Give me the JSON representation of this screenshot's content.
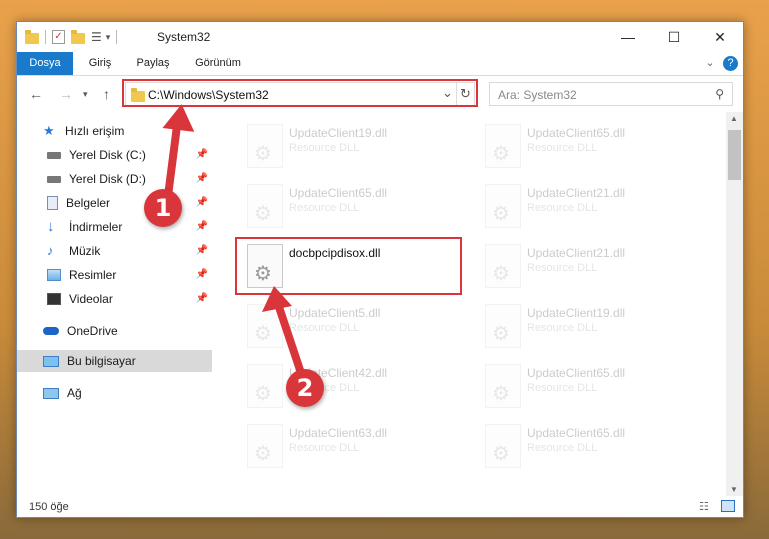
{
  "window": {
    "title": "System32",
    "controls": {
      "minimize": "—",
      "maximize": "☐",
      "close": "✕"
    }
  },
  "ribbon": {
    "tabs": [
      "Dosya",
      "Giriş",
      "Paylaş",
      "Görünüm"
    ],
    "help": "?",
    "collapse": "⌄"
  },
  "navbar": {
    "address": "C:\\Windows\\System32",
    "search_placeholder": "Ara: System32",
    "refresh_icon": "↻",
    "dropdown_icon": "⌄"
  },
  "nav_pane": {
    "items": [
      {
        "label": "Hızlı erişim",
        "icon": "star-icon",
        "pinned": false
      },
      {
        "label": "Yerel Disk (C:)",
        "icon": "drive-icon",
        "pinned": true
      },
      {
        "label": "Yerel Disk (D:)",
        "icon": "drive-icon",
        "pinned": true
      },
      {
        "label": "Belgeler",
        "icon": "documents-icon",
        "pinned": true
      },
      {
        "label": "İndirmeler",
        "icon": "download-icon",
        "pinned": true
      },
      {
        "label": "Müzik",
        "icon": "music-icon",
        "pinned": true
      },
      {
        "label": "Resimler",
        "icon": "pictures-icon",
        "pinned": true
      },
      {
        "label": "Videolar",
        "icon": "videos-icon",
        "pinned": true
      },
      {
        "label": "OneDrive",
        "icon": "cloud-icon",
        "pinned": false
      },
      {
        "label": "Bu bilgisayar",
        "icon": "computer-icon",
        "pinned": false,
        "selected": true
      },
      {
        "label": "Ağ",
        "icon": "network-icon",
        "pinned": false
      }
    ]
  },
  "files": {
    "left": [
      {
        "name": "UpdateClient19.dll",
        "desc": "Resource DLL"
      },
      {
        "name": "UpdateClient65.dll",
        "desc": "Resource DLL"
      },
      {
        "name": "docbpcipdisox.dll",
        "desc": ""
      },
      {
        "name": "UpdateClient5.dll",
        "desc": "Resource DLL"
      },
      {
        "name": "UpdateClient42.dll",
        "desc": "Resource DLL"
      },
      {
        "name": "UpdateClient63.dll",
        "desc": "Resource DLL"
      }
    ],
    "right": [
      {
        "name": "UpdateClient65.dll",
        "desc": "Resource DLL"
      },
      {
        "name": "UpdateClient21.dll",
        "desc": "Resource DLL"
      },
      {
        "name": "UpdateClient21.dll",
        "desc": "Resource DLL"
      },
      {
        "name": "UpdateClient19.dll",
        "desc": "Resource DLL"
      },
      {
        "name": "UpdateClient65.dll",
        "desc": "Resource DLL"
      },
      {
        "name": "UpdateClient65.dll",
        "desc": "Resource DLL"
      }
    ]
  },
  "status": {
    "count": "150 öğe"
  },
  "annotations": {
    "step1": "1",
    "step2": "2",
    "color": "#d8363a"
  }
}
